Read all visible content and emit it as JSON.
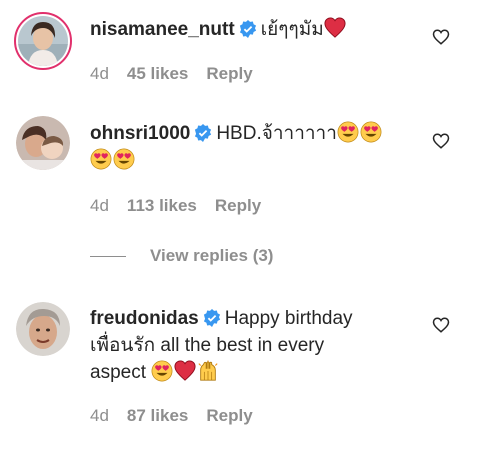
{
  "comments": [
    {
      "username": "nisamanee_nutt",
      "text": "เย้ๆๆมัม",
      "emojis_after": [
        "red-heart"
      ],
      "time": "4d",
      "likes": "45 likes",
      "reply": "Reply"
    },
    {
      "username": "ohnsri1000",
      "text": "HBD.จ้าาาาาา",
      "emojis_line1": [
        "heart-eyes",
        "heart-eyes"
      ],
      "emojis_line2": [
        "heart-eyes",
        "heart-eyes"
      ],
      "time": "4d",
      "likes": "113 likes",
      "reply": "Reply",
      "view_replies": "View replies (3)"
    },
    {
      "username": "freudonidas",
      "text_line1": "Happy birthday",
      "text_line2": "เพื่อนรัก all the best in every",
      "text_line3": "aspect",
      "emojis_after": [
        "heart-eyes",
        "red-heart",
        "raising-hands"
      ],
      "time": "4d",
      "likes": "87 likes",
      "reply": "Reply"
    }
  ],
  "colors": {
    "text": "#262626",
    "muted": "#8e8e8e",
    "verified": "#3897f0",
    "heart": "#e0245e"
  }
}
